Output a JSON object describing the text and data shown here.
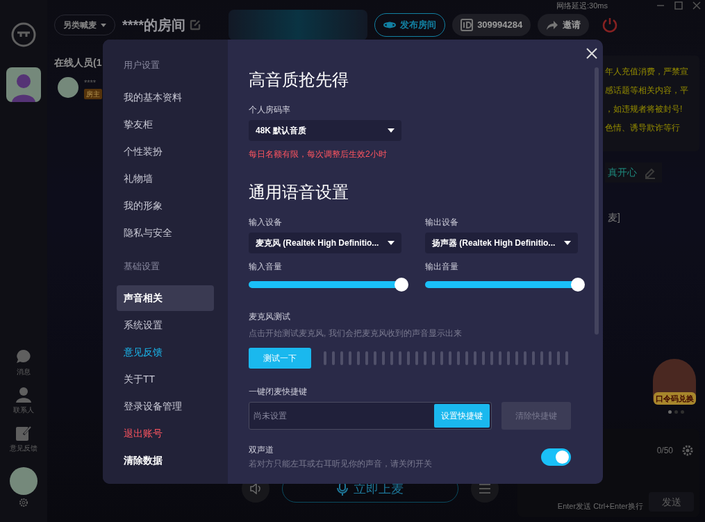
{
  "app": {
    "network_latency": "网络延迟:30ms"
  },
  "rail": {
    "nav": [
      {
        "label": "消息",
        "kind": "chat"
      },
      {
        "label": "联系人",
        "kind": "contact"
      },
      {
        "label": "意见反馈",
        "kind": "feedback"
      }
    ]
  },
  "room": {
    "category": "另类喊麦",
    "title": "****的房间",
    "publish": "发布房间",
    "room_id": "309994284",
    "invite": "邀请"
  },
  "online": {
    "heading": "在线人员(1",
    "members": [
      {
        "name": "****",
        "role": "房主"
      }
    ]
  },
  "notice": {
    "lines": [
      "年人充值消费，严禁宣",
      "感话题等相关内容，平",
      "，如违规者将被封号!",
      "色情、诱导欺诈等行"
    ]
  },
  "topic": "真开心",
  "chat_line": "麦]",
  "promo": {
    "label": "口令码兑换",
    "pages": [
      {
        "selected": true
      },
      {
        "selected": false
      },
      {
        "selected": false
      }
    ]
  },
  "chat_input": {
    "counter": "0/50",
    "hint": "Enter发送 Ctrl+Enter换行",
    "send": "发送"
  },
  "mic_button": "立即上麦",
  "settings": {
    "nav": [
      {
        "title": "用户设置",
        "items": [
          {
            "label": "我的基本资料",
            "kind": "normal",
            "selected": false
          },
          {
            "label": "挚友柜",
            "kind": "normal",
            "selected": false
          },
          {
            "label": "个性装扮",
            "kind": "normal",
            "selected": false
          },
          {
            "label": "礼物墙",
            "kind": "normal",
            "selected": false
          },
          {
            "label": "我的形象",
            "kind": "normal",
            "selected": false
          },
          {
            "label": "隐私与安全",
            "kind": "normal",
            "selected": false
          }
        ]
      },
      {
        "title": "基础设置",
        "items": [
          {
            "label": "声音相关",
            "kind": "normal",
            "selected": true
          },
          {
            "label": "系统设置",
            "kind": "normal",
            "selected": false
          },
          {
            "label": "意见反馈",
            "kind": "accent",
            "selected": false
          },
          {
            "label": "关于TT",
            "kind": "normal",
            "selected": false
          },
          {
            "label": "登录设备管理",
            "kind": "normal",
            "selected": false
          },
          {
            "label": "退出账号",
            "kind": "danger",
            "selected": false
          },
          {
            "label": "清除数据",
            "kind": "strong",
            "selected": false
          }
        ]
      }
    ],
    "quality": {
      "title": "高音质抢先得",
      "label": "个人房码率",
      "value": "48K 默认音质",
      "note": "每日名额有限，每次调整后生效2小时"
    },
    "voice": {
      "title": "通用语音设置",
      "devices": [
        {
          "label": "输入设备",
          "value": "麦克风 (Realtek High Definitio...",
          "volume_label": "输入音量",
          "level": 1
        },
        {
          "label": "输出设备",
          "value": "扬声器 (Realtek High Definitio...",
          "volume_label": "输出音量",
          "level": 1
        }
      ],
      "mic_test": {
        "title": "麦克风测试",
        "description": "点击开始测试麦克风, 我们会把麦克风收到的声音显示出来",
        "button": "测试一下"
      },
      "hotkey": {
        "label": "一键闭麦快捷键",
        "placeholder": "尚未设置",
        "set_button": "设置快捷键",
        "clear_button": "清除快捷键",
        "clear_disabled": true
      },
      "stereo": {
        "title": "双声道",
        "description": "若对方只能左耳或右耳听见你的声音，请关闭开关",
        "on": true
      }
    }
  }
}
